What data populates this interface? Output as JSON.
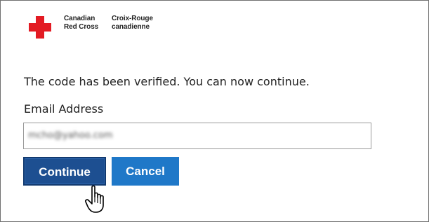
{
  "logo": {
    "name_en_line1": "Canadian",
    "name_en_line2": "Red Cross",
    "name_fr_line1": "Croix-Rouge",
    "name_fr_line2": "canadienne",
    "cross_color": "#e31b23"
  },
  "message": "The code has been verified. You can now continue.",
  "email": {
    "label": "Email Address",
    "value": "mcho@yahoo.com"
  },
  "buttons": {
    "continue_label": "Continue",
    "cancel_label": "Cancel"
  },
  "colors": {
    "continue_bg": "#1d4f91",
    "cancel_bg": "#1f78c8"
  },
  "cursor": "hand-pointer-icon"
}
